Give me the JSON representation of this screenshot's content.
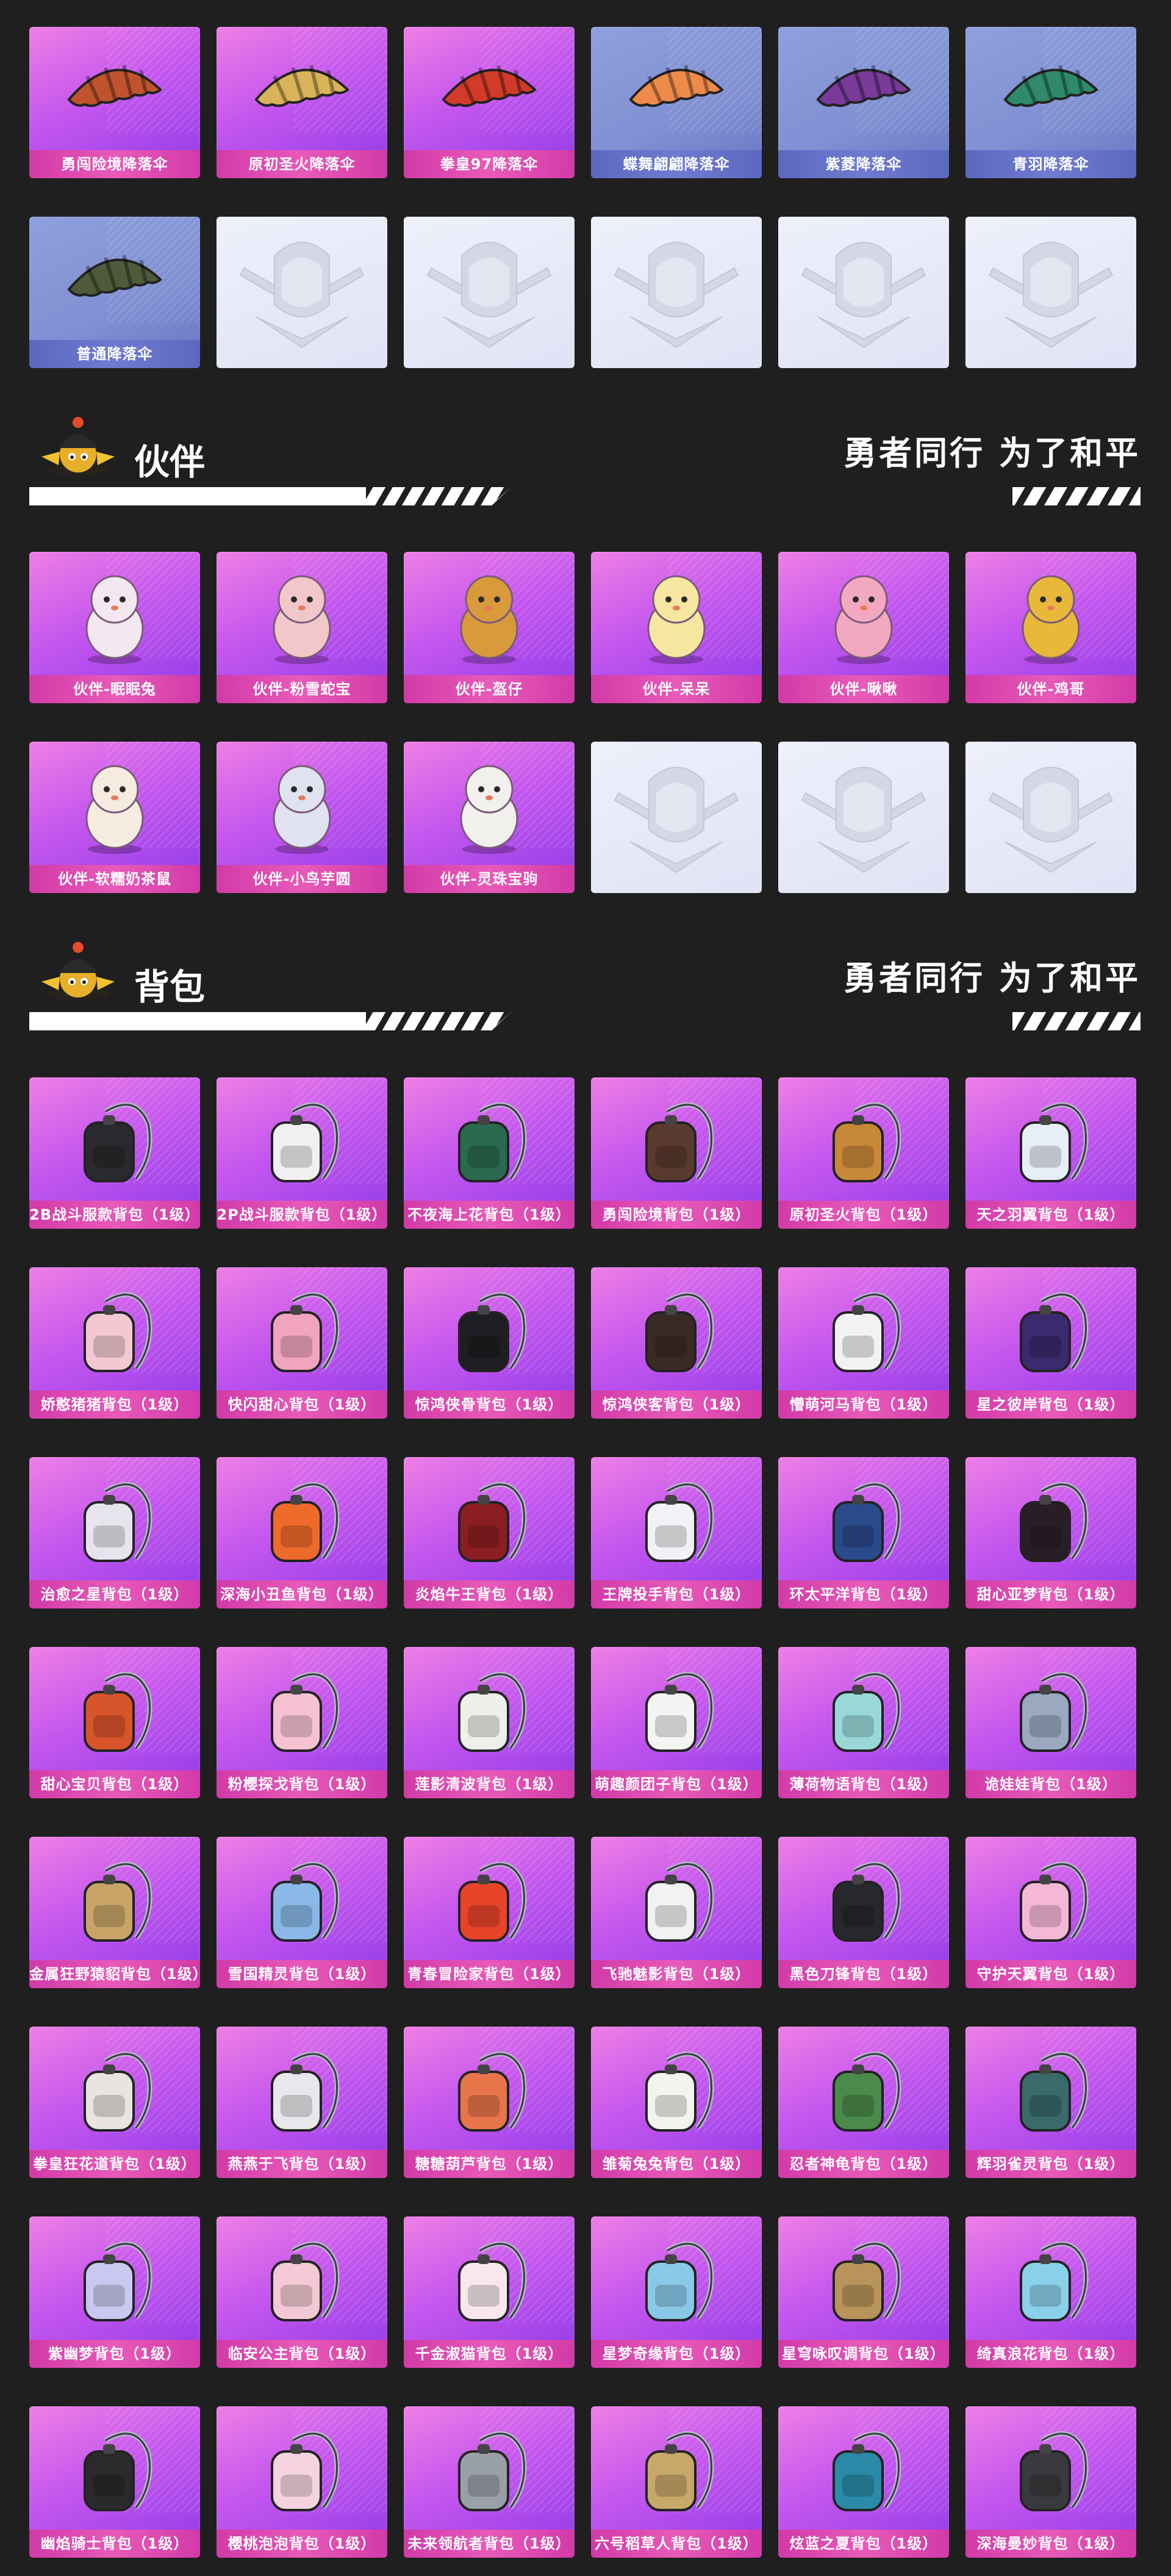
{
  "parachutes": [
    {
      "label": "勇闯险境降落伞",
      "style": "pink",
      "icon": "parachute-icon",
      "color": "#c0532e"
    },
    {
      "label": "原初圣火降落伞",
      "style": "pink",
      "icon": "parachute-icon",
      "color": "#d9b35a"
    },
    {
      "label": "拳皇97降落伞",
      "style": "pink",
      "icon": "parachute-icon",
      "color": "#d23a2a"
    },
    {
      "label": "蝶舞翩翩降落伞",
      "style": "blue",
      "icon": "parachute-icon",
      "color": "#ee8a4a"
    },
    {
      "label": "紫菱降落伞",
      "style": "blue",
      "icon": "parachute-icon",
      "color": "#7a3a9a"
    },
    {
      "label": "青羽降落伞",
      "style": "blue",
      "icon": "parachute-icon",
      "color": "#2e8a6a"
    },
    {
      "label": "普通降落伞",
      "style": "blue",
      "icon": "parachute-icon",
      "color": "#4f5a3a"
    },
    {
      "label": "",
      "style": "empty",
      "icon": "emblem-icon",
      "color": ""
    },
    {
      "label": "",
      "style": "empty",
      "icon": "emblem-icon",
      "color": ""
    },
    {
      "label": "",
      "style": "empty",
      "icon": "emblem-icon",
      "color": ""
    },
    {
      "label": "",
      "style": "empty",
      "icon": "emblem-icon",
      "color": ""
    },
    {
      "label": "",
      "style": "empty",
      "icon": "emblem-icon",
      "color": ""
    }
  ],
  "companion_section": {
    "title": "伙伴",
    "slogan": "勇者同行 为了和平"
  },
  "companions": [
    {
      "label": "伙伴-眠眠兔",
      "style": "pink",
      "icon": "companion-icon",
      "color": "#f4e8f0"
    },
    {
      "label": "伙伴-粉雪蛇宝",
      "style": "pink",
      "icon": "companion-icon",
      "color": "#f2c7c9"
    },
    {
      "label": "伙伴-盔仔",
      "style": "pink",
      "icon": "companion-icon",
      "color": "#d89a3a"
    },
    {
      "label": "伙伴-呆呆",
      "style": "pink",
      "icon": "companion-icon",
      "color": "#f6e6a0"
    },
    {
      "label": "伙伴-啾啾",
      "style": "pink",
      "icon": "companion-icon",
      "color": "#f2a9c0"
    },
    {
      "label": "伙伴-鸡哥",
      "style": "pink",
      "icon": "companion-icon",
      "color": "#e8b83a"
    },
    {
      "label": "伙伴-软糯奶茶鼠",
      "style": "pink",
      "icon": "companion-icon",
      "color": "#f5ecdf"
    },
    {
      "label": "伙伴-小鸟芋圆",
      "style": "pink",
      "icon": "companion-icon",
      "color": "#e0e2f2"
    },
    {
      "label": "伙伴-灵珠宝驹",
      "style": "pink",
      "icon": "companion-icon",
      "color": "#f2f0ec"
    },
    {
      "label": "",
      "style": "empty",
      "icon": "emblem-icon",
      "color": ""
    },
    {
      "label": "",
      "style": "empty",
      "icon": "emblem-icon",
      "color": ""
    },
    {
      "label": "",
      "style": "empty",
      "icon": "emblem-icon",
      "color": ""
    }
  ],
  "backpack_section": {
    "title": "背包",
    "slogan": "勇者同行 为了和平"
  },
  "backpacks": [
    {
      "label": "2B战斗服款背包（1级）",
      "color": "#2a2a2e"
    },
    {
      "label": "2P战斗服款背包（1级）",
      "color": "#f0f0f2"
    },
    {
      "label": "不夜海上花背包（1级）",
      "color": "#2a6a4e"
    },
    {
      "label": "勇闯险境背包（1级）",
      "color": "#5a3a2e"
    },
    {
      "label": "原初圣火背包（1级）",
      "color": "#c8883a"
    },
    {
      "label": "天之羽翼背包（1级）",
      "color": "#e8eef8"
    },
    {
      "label": "娇憨猪猪背包（1级）",
      "color": "#f4c8d2"
    },
    {
      "label": "快闪甜心背包（1级）",
      "color": "#f0a4be"
    },
    {
      "label": "惊鸿侠骨背包（1级）",
      "color": "#1e1e22"
    },
    {
      "label": "惊鸿侠客背包（1级）",
      "color": "#3a2a26"
    },
    {
      "label": "懵萌河马背包（1级）",
      "color": "#f2f2f4"
    },
    {
      "label": "星之彼岸背包（1级）",
      "color": "#3a2a6e"
    },
    {
      "label": "治愈之星背包（1级）",
      "color": "#e8e4ee"
    },
    {
      "label": "深海小丑鱼背包（1级）",
      "color": "#ee6a2a"
    },
    {
      "label": "炎焰牛王背包（1级）",
      "color": "#8a1e22"
    },
    {
      "label": "王牌投手背包（1级）",
      "color": "#f2f2f6"
    },
    {
      "label": "环太平洋背包（1级）",
      "color": "#2a4a8a"
    },
    {
      "label": "甜心亚梦背包（1级）",
      "color": "#2a1e26"
    },
    {
      "label": "甜心宝贝背包（1级）",
      "color": "#d8542a"
    },
    {
      "label": "粉樱探戈背包（1级）",
      "color": "#f6c2d2"
    },
    {
      "label": "莲影清波背包（1级）",
      "color": "#eef0ea"
    },
    {
      "label": "萌趣颜团子背包（1级）",
      "color": "#f4f4f2"
    },
    {
      "label": "薄荷物语背包（1级）",
      "color": "#9ad8d8"
    },
    {
      "label": "诡娃娃背包（1级）",
      "color": "#9aa8c0"
    },
    {
      "label": "金属狂野猿貂背包（1级）",
      "color": "#c8a468"
    },
    {
      "label": "雪国精灵背包（1级）",
      "color": "#8ab8e8"
    },
    {
      "label": "青春冒险家背包（1级）",
      "color": "#e8442a"
    },
    {
      "label": "飞驰魅影背包（1级）",
      "color": "#f2f2f4"
    },
    {
      "label": "黑色刀锋背包（1级）",
      "color": "#26282c"
    },
    {
      "label": "守护天翼背包（1级）",
      "color": "#f4b8d6"
    },
    {
      "label": "拳皇狂花道背包（1级）",
      "color": "#e8e4e0"
    },
    {
      "label": "燕燕于飞背包（1级）",
      "color": "#e8e8ec"
    },
    {
      "label": "糖糖葫芦背包（1级）",
      "color": "#e8744a"
    },
    {
      "label": "雏菊兔兔背包（1级）",
      "color": "#f2f4ee"
    },
    {
      "label": "忍者神龟背包（1级）",
      "color": "#4a8a4a"
    },
    {
      "label": "辉羽雀灵背包（1级）",
      "color": "#3a6a6a"
    },
    {
      "label": "紫幽梦背包（1级）",
      "color": "#c8c8f0"
    },
    {
      "label": "临安公主背包（1级）",
      "color": "#f4c8d4"
    },
    {
      "label": "千金淑猫背包（1级）",
      "color": "#f8e8ee"
    },
    {
      "label": "星梦奇缘背包（1级）",
      "color": "#8ac8e8"
    },
    {
      "label": "星穹咏叹调背包（1级）",
      "color": "#b8945a"
    },
    {
      "label": "绮真浪花背包（1级）",
      "color": "#8ad0e8"
    },
    {
      "label": "幽焰骑士背包（1级）",
      "color": "#2a2a2c"
    },
    {
      "label": "樱桃泡泡背包（1级）",
      "color": "#f4d2de"
    },
    {
      "label": "未来领航者背包（1级）",
      "color": "#9aa0a8"
    },
    {
      "label": "六号稻草人背包（1级）",
      "color": "#c8a86a"
    },
    {
      "label": "炫蓝之夏背包（1级）",
      "color": "#2a8aa8"
    },
    {
      "label": "深海曼妙背包（1级）",
      "color": "#3a3a3e"
    }
  ]
}
